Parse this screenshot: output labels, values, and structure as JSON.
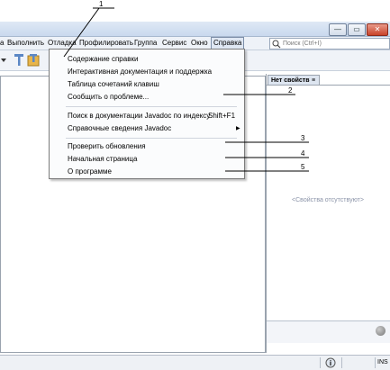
{
  "menubar": {
    "items": [
      "а",
      "Выполнить",
      "Отладка",
      "Профилировать",
      "Группа",
      "Сервис",
      "Окно",
      "Справка"
    ],
    "search_placeholder": "Поиск (Ctrl+I)"
  },
  "help_menu": {
    "items": [
      {
        "label": "Содержание справки"
      },
      {
        "label": "Интерактивная документация и поддержка"
      },
      {
        "label": "Таблица сочетаний клавиш"
      },
      {
        "label": "Сообщить о проблеме..."
      },
      {
        "label": "Поиск в документации Javadoc по индексу",
        "shortcut": "Shift+F1"
      },
      {
        "label": "Справочные сведения Javadoc",
        "has_submenu": true
      },
      {
        "label": "Проверить обновления"
      },
      {
        "label": "Начальная страница"
      },
      {
        "label": "О программе"
      }
    ]
  },
  "properties": {
    "tab_title": "Нет свойств",
    "empty_text": "<Свойства отсутствуют>"
  },
  "status": {
    "ins": "INS"
  },
  "callouts": [
    "1",
    "2",
    "3",
    "4",
    "5"
  ],
  "icons": [
    "minimize-icon",
    "restore-icon",
    "close-icon",
    "search-icon",
    "hammer-icon",
    "clean-build-icon",
    "dropdown-arrow-icon",
    "info-icon",
    "submenu-arrow-icon",
    "panel-close-icon"
  ]
}
